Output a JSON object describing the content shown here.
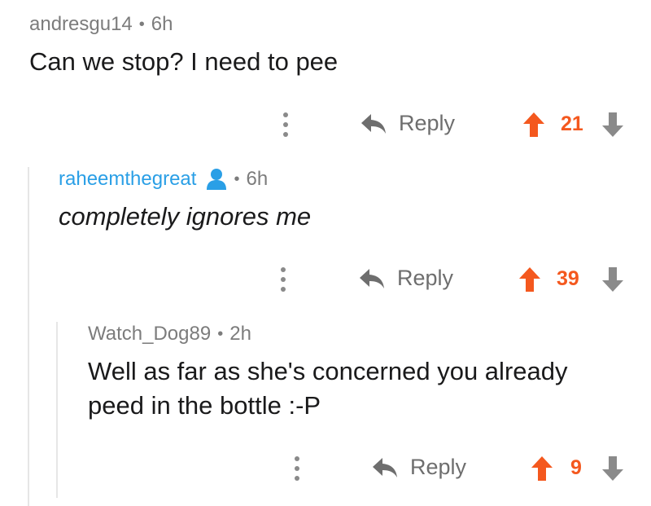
{
  "comments": [
    {
      "username": "andresgu14",
      "time": "6h",
      "separator": "•",
      "body": "Can we stop? I need to pee",
      "reply_label": "Reply",
      "score": "21"
    },
    {
      "username": "raheemthegreat",
      "time": "6h",
      "separator": "•",
      "body": "completely ignores me",
      "reply_label": "Reply",
      "score": "39",
      "user_icon": "user-icon"
    },
    {
      "username": "Watch_Dog89",
      "time": "2h",
      "separator": "•",
      "body_lines": [
        "Well as far as she's concerned you already",
        "peed in the bottle :-P"
      ],
      "reply_label": "Reply",
      "score": "9"
    }
  ],
  "colors": {
    "upvote": "#f4581e",
    "downvote": "#8a8a8a",
    "op_username": "#2a9fe6",
    "meta_text": "#7c7c7c"
  }
}
